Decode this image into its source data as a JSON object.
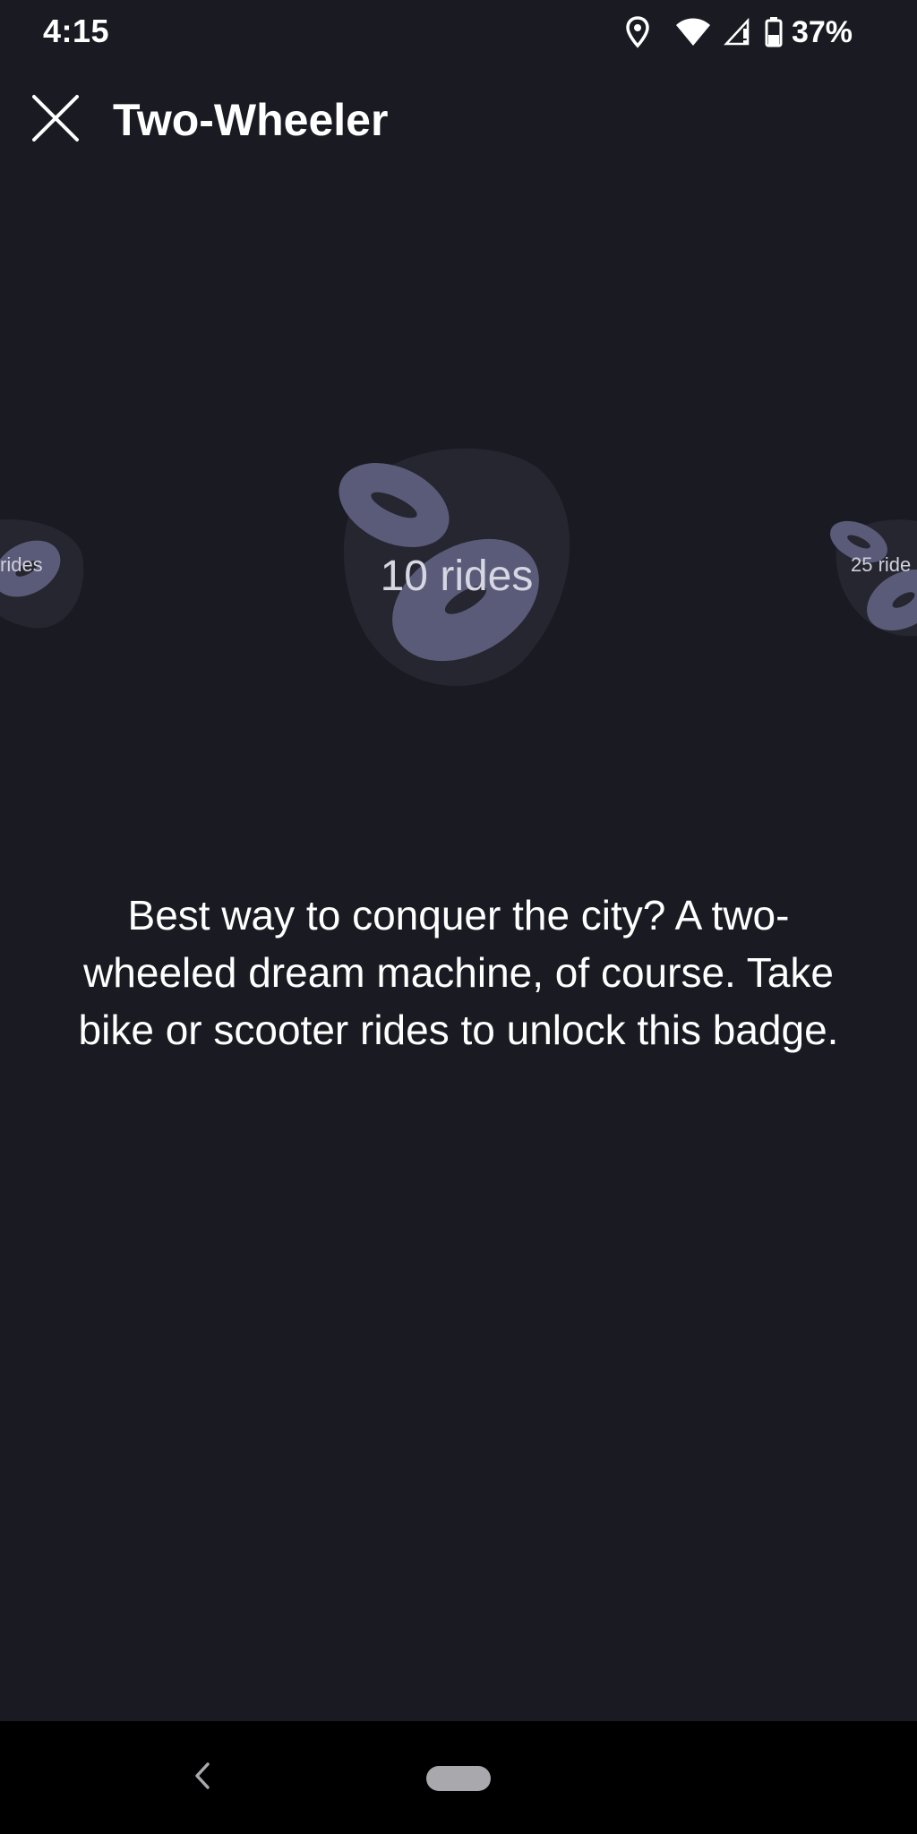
{
  "status_bar": {
    "time": "4:15",
    "battery_percent": "37%",
    "icons": [
      "location-icon",
      "wifi-icon",
      "signal-icon",
      "battery-icon"
    ]
  },
  "app_bar": {
    "title": "Two-Wheeler",
    "close_icon": "close-icon"
  },
  "badges": {
    "previous": {
      "label": "rides"
    },
    "current": {
      "label": "10 rides"
    },
    "next": {
      "label": "25 ride"
    }
  },
  "description": "Best way to conquer the city? A two-wheeled dream machine, of course. Take bike or scooter rides to unlock this badge.",
  "colors": {
    "background": "#1a1b22",
    "badge_shape": "#5a5b78",
    "badge_blob": "#25262f",
    "nav_bar": "#000000"
  },
  "nav_bar": {
    "back_icon": "back-chevron-icon",
    "home_icon": "home-pill-icon"
  }
}
